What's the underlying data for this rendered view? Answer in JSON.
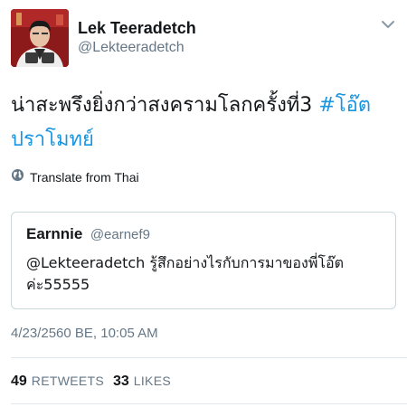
{
  "author": {
    "display_name": "Lek Teeradetch",
    "handle": "@Lekteeradetch"
  },
  "tweet": {
    "text": "น่าสะพรึงยิ่งกว่าสงครามโลกครั้งที่3 ",
    "hashtag": "#โอ๊ตปราโมทย์"
  },
  "translate": {
    "label": "Translate from Thai",
    "icon": "globe-icon"
  },
  "quoted_tweet": {
    "display_name": "Earnnie",
    "handle": "@earnef9",
    "text": "@Lekteeradetch รู้สึกอย่างไรกับการมาของพี่โอ๊ต ค่ะ55555"
  },
  "timestamp": "4/23/2560 BE, 10:05 AM",
  "stats": {
    "retweets_count": "49",
    "retweets_label": "RETWEETS",
    "likes_count": "33",
    "likes_label": "LIKES"
  },
  "colors": {
    "link": "#1b95e0",
    "secondary_text": "#657786",
    "primary_text": "#14171a",
    "border": "#ccd6dd"
  }
}
